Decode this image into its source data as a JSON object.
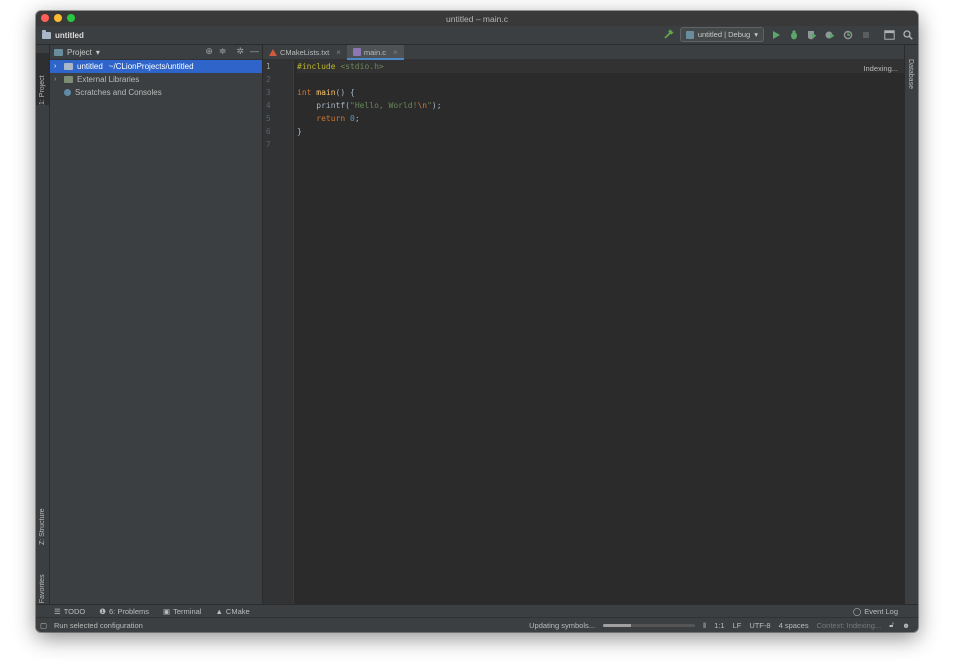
{
  "window": {
    "title": "untitled – main.c"
  },
  "navbar": {
    "project": "untitled"
  },
  "toolbar": {
    "run_config": "untitled | Debug"
  },
  "left_strip": {
    "project_tab": "1: Project",
    "structure_tab": "Z: Structure",
    "favorites_tab": "2: Favorites"
  },
  "right_strip": {
    "database_tab": "Database"
  },
  "project_panel": {
    "title": "Project",
    "items": [
      {
        "name": "untitled",
        "path": "~/CLionProjects/untitled"
      },
      {
        "name": "External Libraries"
      },
      {
        "name": "Scratches and Consoles"
      }
    ]
  },
  "editor": {
    "tabs": [
      {
        "label": "CMakeLists.txt"
      },
      {
        "label": "main.c"
      }
    ],
    "line_numbers": [
      "1",
      "2",
      "3",
      "4",
      "5",
      "6",
      "7"
    ],
    "code": {
      "l1_directive": "#include",
      "l1_header": "<stdio.h>",
      "l3_type": "int",
      "l3_fn": "main",
      "l3_rest": "() {",
      "l4_call": "printf",
      "l4_open": "(",
      "l4_str": "\"Hello, World!",
      "l4_esc": "\\n",
      "l4_strend": "\"",
      "l4_close": ");",
      "l5_kw": "return",
      "l5_num": "0",
      "l5_end": ";",
      "l6": "}"
    },
    "indexing_label": "Indexing..."
  },
  "tool_windows": {
    "todo": "TODO",
    "problems": "6: Problems",
    "terminal": "Terminal",
    "cmake": "CMake",
    "event_log": "Event Log"
  },
  "status": {
    "message": "Run selected configuration",
    "updating": "Updating symbols...",
    "progress": 0.3,
    "position": "1:1",
    "line_sep": "LF",
    "encoding": "UTF-8",
    "indent": "4 spaces",
    "context": "Context: Indexing..."
  }
}
